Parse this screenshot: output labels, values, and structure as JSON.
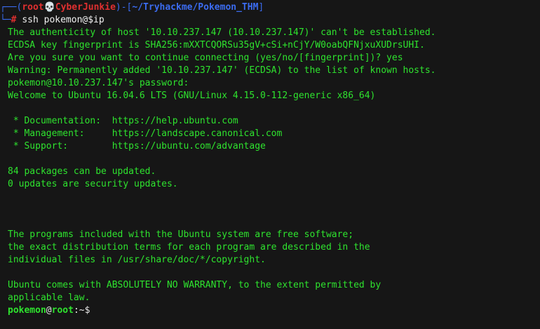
{
  "prompt": {
    "corner_top": "┌──(",
    "user": "root",
    "skull": "💀",
    "host": "CyberJunkie",
    "close_paren": ")-[",
    "path": "~/Tryhackme/Pokemon_THM",
    "close_bracket": "]",
    "corner_bottom": "└─",
    "hash": "#",
    "command": "ssh pokemon@$ip"
  },
  "output_lines": [
    "The authenticity of host '10.10.237.147 (10.10.237.147)' can't be established.",
    "ECDSA key fingerprint is SHA256:mXXTCQORSu35gV+cSi+nCjY/W0oabQFNjxuXUDrsUHI.",
    "Are you sure you want to continue connecting (yes/no/[fingerprint])? yes",
    "Warning: Permanently added '10.10.237.147' (ECDSA) to the list of known hosts.",
    "pokemon@10.10.237.147's password:",
    "Welcome to Ubuntu 16.04.6 LTS (GNU/Linux 4.15.0-112-generic x86_64)",
    "",
    " * Documentation:  https://help.ubuntu.com",
    " * Management:     https://landscape.canonical.com",
    " * Support:        https://ubuntu.com/advantage",
    "",
    "84 packages can be updated.",
    "0 updates are security updates.",
    "",
    "",
    "",
    "The programs included with the Ubuntu system are free software;",
    "the exact distribution terms for each program are described in the",
    "individual files in /usr/share/doc/*/copyright.",
    "",
    "Ubuntu comes with ABSOLUTELY NO WARRANTY, to the extent permitted by",
    "applicable law.",
    ""
  ],
  "remote_prompt": {
    "user": "pokemon",
    "at": "@",
    "host": "root",
    "sep": ":~",
    "dollar": "$"
  },
  "colors": {
    "background": "#161616",
    "output_green": "#2ee32e",
    "prompt_red": "#e03030",
    "prompt_blue": "#3b6cf0"
  }
}
